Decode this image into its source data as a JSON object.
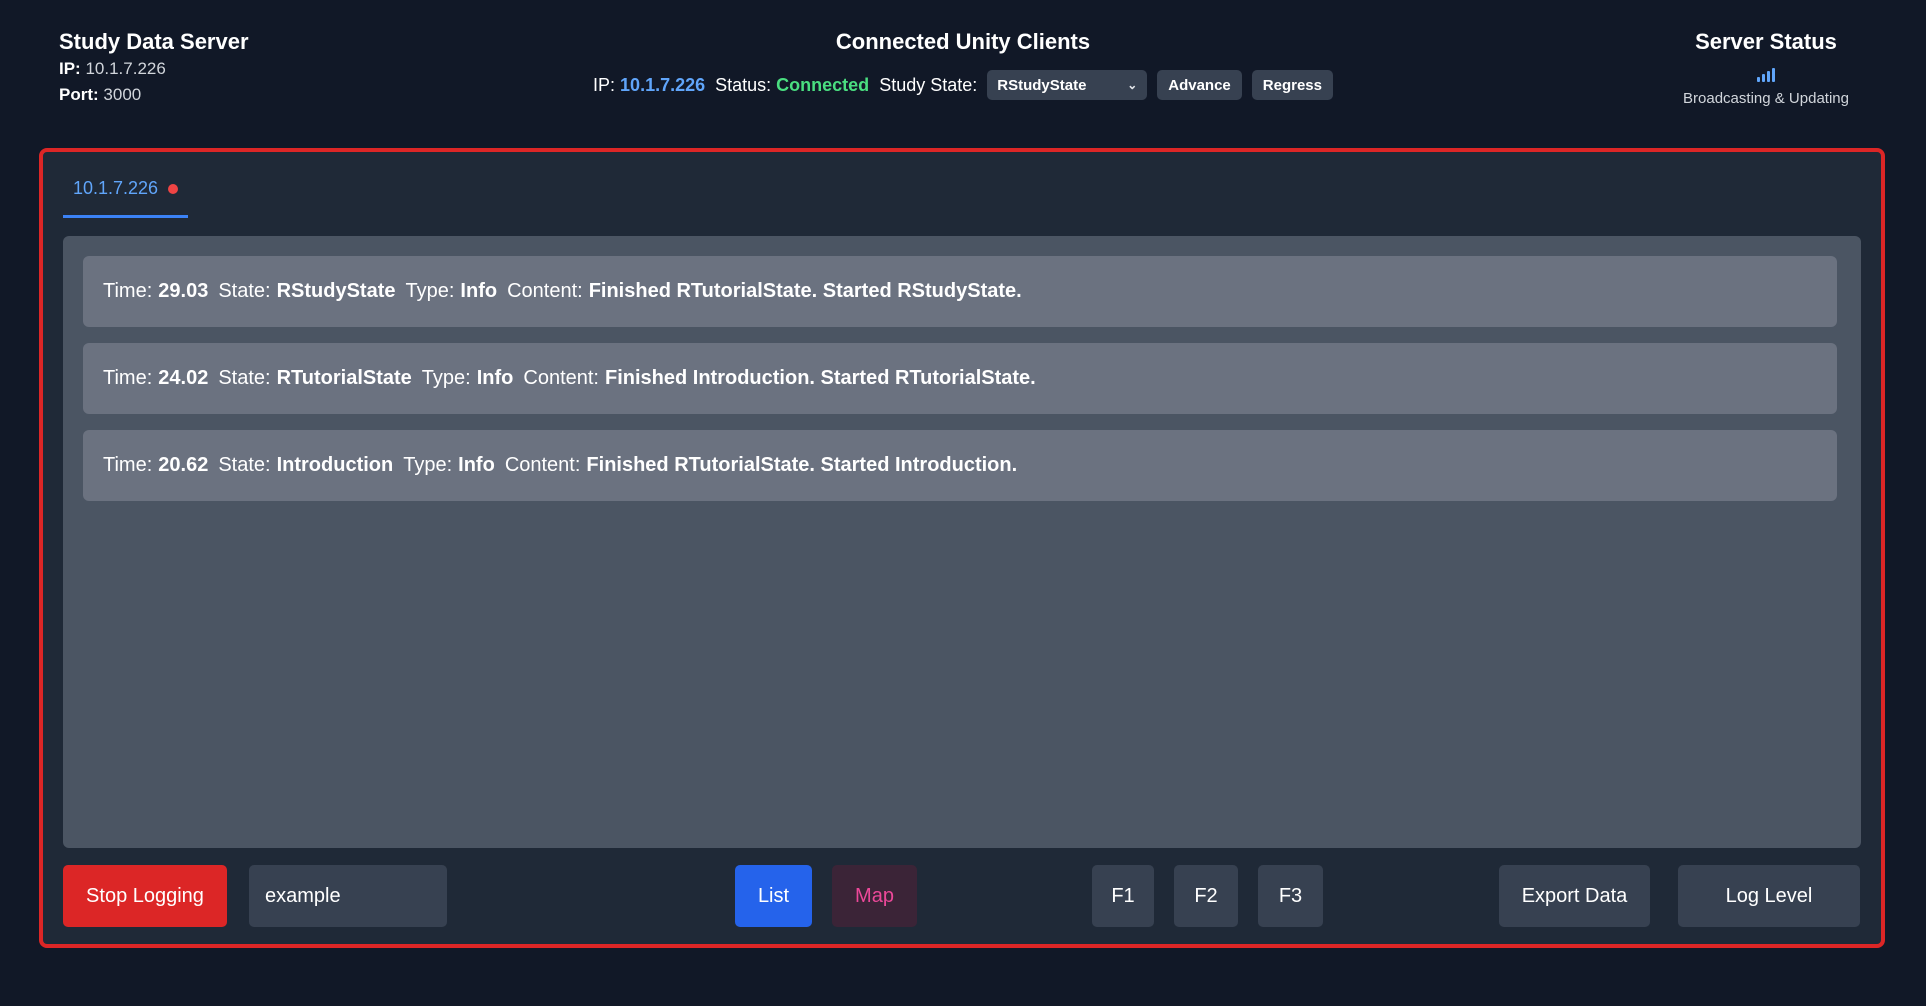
{
  "server": {
    "title": "Study Data Server",
    "ip_label": "IP:",
    "ip_value": "10.1.7.226",
    "port_label": "Port:",
    "port_value": "3000"
  },
  "clients": {
    "title": "Connected Unity Clients",
    "ip_label": "IP:",
    "ip_value": "10.1.7.226",
    "status_label": "Status:",
    "status_value": "Connected",
    "state_label": "Study State:",
    "state_selected": "RStudyState",
    "advance_label": "Advance",
    "regress_label": "Regress"
  },
  "status": {
    "title": "Server Status",
    "icon": "signal-bars-icon",
    "subtitle": "Broadcasting & Updating"
  },
  "tabs": [
    {
      "label": "10.1.7.226",
      "active": true,
      "indicator_color": "#ef4444"
    }
  ],
  "log_labels": {
    "time": "Time:",
    "state": "State:",
    "type": "Type:",
    "content": "Content:"
  },
  "logs": [
    {
      "time": "29.03",
      "state": "RStudyState",
      "type": "Info",
      "content": "Finished RTutorialState. Started RStudyState."
    },
    {
      "time": "24.02",
      "state": "RTutorialState",
      "type": "Info",
      "content": "Finished Introduction. Started RTutorialState."
    },
    {
      "time": "20.62",
      "state": "Introduction",
      "type": "Info",
      "content": "Finished RTutorialState. Started Introduction."
    }
  ],
  "footer": {
    "stop_label": "Stop Logging",
    "input_value": "example",
    "list_label": "List",
    "map_label": "Map",
    "f1_label": "F1",
    "f2_label": "F2",
    "f3_label": "F3",
    "export_label": "Export Data",
    "log_level_label": "Log Level"
  },
  "colors": {
    "background": "#111827",
    "panel_border": "#dc2626",
    "accent_blue": "#3b82f6",
    "connected_green": "#4ade80",
    "map_pink": "#ec4899"
  }
}
